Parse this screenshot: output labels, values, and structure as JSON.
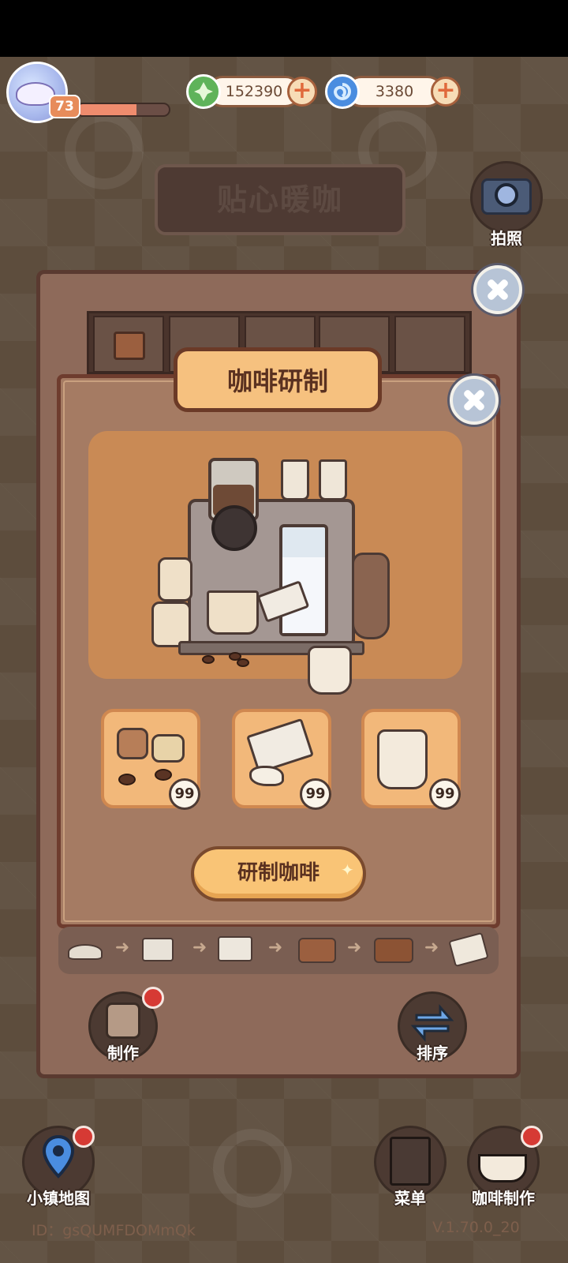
{
  "player": {
    "level": "73",
    "xp_fraction": 0.65
  },
  "currencies": [
    {
      "name": "leaf-coin",
      "value": "152390",
      "color": "#5fb35a"
    },
    {
      "name": "swirl-gem",
      "value": "3380",
      "color": "#4a8de0"
    }
  ],
  "shop": {
    "sign": "贴心暖咖"
  },
  "camera": {
    "label": "拍照"
  },
  "modal": {
    "title": "咖啡研制",
    "ingredients": [
      {
        "name": "coffee-grounds",
        "count": "99"
      },
      {
        "name": "sugar-pack",
        "count": "99"
      },
      {
        "name": "milk-pitcher",
        "count": "99"
      }
    ],
    "grind_button": "研制咖啡"
  },
  "panel": {
    "make_label": "制作",
    "sort_label": "排序"
  },
  "bottom_nav": {
    "map_label": "小镇地图",
    "menu_label": "菜单",
    "coffee_label": "咖啡制作"
  },
  "footer": {
    "id": "ID：gsQUMFDOMmQk",
    "version": "V.1.70.0_20"
  }
}
